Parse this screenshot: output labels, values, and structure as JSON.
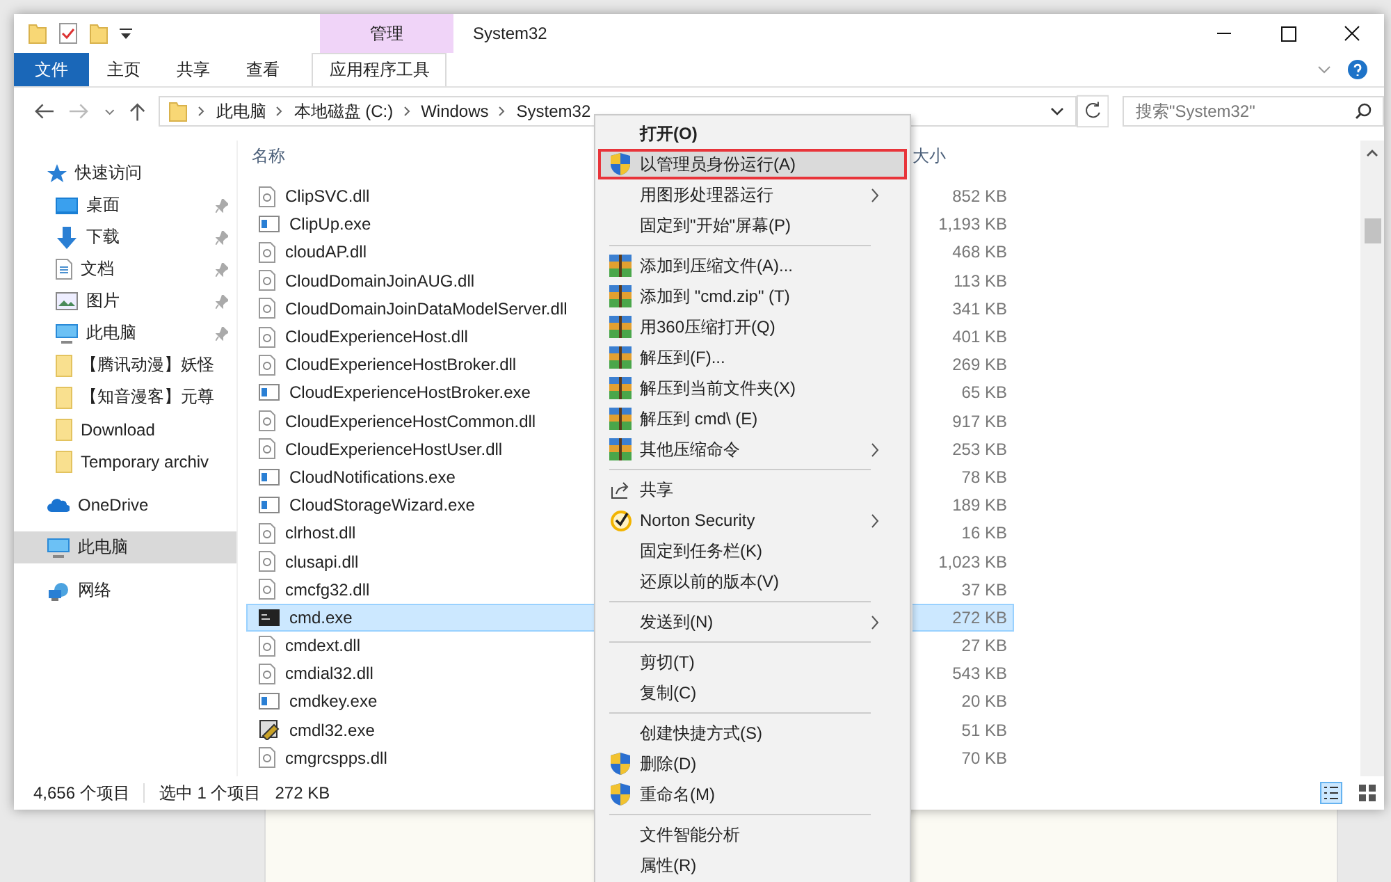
{
  "window": {
    "title": "System32",
    "context_group": "管理"
  },
  "ribbon_tabs": [
    {
      "label": "文件",
      "kind": "file",
      "selected": false
    },
    {
      "label": "主页",
      "kind": "tab",
      "selected": false
    },
    {
      "label": "共享",
      "kind": "tab",
      "selected": false
    },
    {
      "label": "查看",
      "kind": "tab",
      "selected": false
    },
    {
      "label": "应用程序工具",
      "kind": "context",
      "selected": true
    }
  ],
  "address": {
    "crumbs": [
      "此电脑",
      "本地磁盘 (C:)",
      "Windows",
      "System32"
    ]
  },
  "search": {
    "placeholder": "搜索\"System32\""
  },
  "sidebar": {
    "items": [
      {
        "label": "快速访问",
        "kind": "star",
        "selected": false,
        "children": [
          {
            "label": "桌面",
            "kind": "desktop",
            "pinned": true,
            "selected": false
          },
          {
            "label": "下载",
            "kind": "download",
            "pinned": true,
            "selected": false
          },
          {
            "label": "文档",
            "kind": "document",
            "pinned": true,
            "selected": false
          },
          {
            "label": "图片",
            "kind": "pictures",
            "pinned": true,
            "selected": false
          },
          {
            "label": "此电脑",
            "kind": "pc",
            "pinned": true,
            "selected": false
          },
          {
            "label": "【腾讯动漫】妖怪",
            "kind": "folder",
            "pinned": false,
            "selected": false
          },
          {
            "label": "【知音漫客】元尊",
            "kind": "folder",
            "pinned": false,
            "selected": false
          },
          {
            "label": "Download",
            "kind": "folder",
            "pinned": false,
            "selected": false
          },
          {
            "label": "Temporary archiv",
            "kind": "folder",
            "pinned": false,
            "selected": false
          }
        ]
      },
      {
        "label": "OneDrive",
        "kind": "cloud",
        "selected": false
      },
      {
        "label": "此电脑",
        "kind": "pc",
        "selected": true
      },
      {
        "label": "网络",
        "kind": "network",
        "selected": false
      }
    ]
  },
  "table": {
    "columns": [
      "名称",
      "大小"
    ],
    "rows": [
      {
        "name": "ClipSVC.dll",
        "size": "852 KB",
        "kind": "dll",
        "selected": false
      },
      {
        "name": "ClipUp.exe",
        "size": "1,193 KB",
        "kind": "exe",
        "selected": false
      },
      {
        "name": "cloudAP.dll",
        "size": "468 KB",
        "kind": "dll",
        "selected": false
      },
      {
        "name": "CloudDomainJoinAUG.dll",
        "size": "113 KB",
        "kind": "dll",
        "selected": false
      },
      {
        "name": "CloudDomainJoinDataModelServer.dll",
        "size": "341 KB",
        "kind": "dll",
        "selected": false
      },
      {
        "name": "CloudExperienceHost.dll",
        "size": "401 KB",
        "kind": "dll",
        "selected": false
      },
      {
        "name": "CloudExperienceHostBroker.dll",
        "size": "269 KB",
        "kind": "dll",
        "selected": false
      },
      {
        "name": "CloudExperienceHostBroker.exe",
        "size": "65 KB",
        "kind": "exe",
        "selected": false
      },
      {
        "name": "CloudExperienceHostCommon.dll",
        "size": "917 KB",
        "kind": "dll",
        "selected": false
      },
      {
        "name": "CloudExperienceHostUser.dll",
        "size": "253 KB",
        "kind": "dll",
        "selected": false
      },
      {
        "name": "CloudNotifications.exe",
        "size": "78 KB",
        "kind": "exe",
        "selected": false
      },
      {
        "name": "CloudStorageWizard.exe",
        "size": "189 KB",
        "kind": "exe",
        "selected": false
      },
      {
        "name": "clrhost.dll",
        "size": "16 KB",
        "kind": "dll",
        "selected": false
      },
      {
        "name": "clusapi.dll",
        "size": "1,023 KB",
        "kind": "dll",
        "selected": false
      },
      {
        "name": "cmcfg32.dll",
        "size": "37 KB",
        "kind": "dll",
        "selected": false
      },
      {
        "name": "cmd.exe",
        "size": "272 KB",
        "kind": "console",
        "selected": true
      },
      {
        "name": "cmdext.dll",
        "size": "27 KB",
        "kind": "dll",
        "selected": false
      },
      {
        "name": "cmdial32.dll",
        "size": "543 KB",
        "kind": "dll",
        "selected": false
      },
      {
        "name": "cmdkey.exe",
        "size": "20 KB",
        "kind": "exe",
        "selected": false
      },
      {
        "name": "cmdl32.exe",
        "size": "51 KB",
        "kind": "setup",
        "selected": false
      },
      {
        "name": "cmgrcspps.dll",
        "size": "70 KB",
        "kind": "dll",
        "selected": false
      }
    ]
  },
  "status_bar": {
    "count": "4,656 个项目",
    "selection": "选中 1 个项目",
    "size": "272 KB"
  },
  "context_menu": {
    "items": [
      {
        "kind": "plain",
        "label": "打开(O)",
        "bold": true,
        "submenu": false,
        "selected": false,
        "outlined": false
      },
      {
        "kind": "shield",
        "label": "以管理员身份运行(A)",
        "bold": false,
        "submenu": false,
        "selected": true,
        "outlined": true
      },
      {
        "kind": "plain",
        "label": "用图形处理器运行",
        "bold": false,
        "submenu": true,
        "selected": false,
        "outlined": false
      },
      {
        "kind": "plain",
        "label": "固定到\"开始\"屏幕(P)",
        "bold": false,
        "submenu": false,
        "selected": false,
        "outlined": false
      },
      {
        "kind": "separator"
      },
      {
        "kind": "archive",
        "label": "添加到压缩文件(A)...",
        "bold": false,
        "submenu": false,
        "selected": false,
        "outlined": false
      },
      {
        "kind": "archive",
        "label": "添加到 \"cmd.zip\" (T)",
        "bold": false,
        "submenu": false,
        "selected": false,
        "outlined": false
      },
      {
        "kind": "archive",
        "label": "用360压缩打开(Q)",
        "bold": false,
        "submenu": false,
        "selected": false,
        "outlined": false
      },
      {
        "kind": "archive",
        "label": "解压到(F)...",
        "bold": false,
        "submenu": false,
        "selected": false,
        "outlined": false
      },
      {
        "kind": "archive",
        "label": "解压到当前文件夹(X)",
        "bold": false,
        "submenu": false,
        "selected": false,
        "outlined": false
      },
      {
        "kind": "archive",
        "label": "解压到 cmd\\ (E)",
        "bold": false,
        "submenu": false,
        "selected": false,
        "outlined": false
      },
      {
        "kind": "archive",
        "label": "其他压缩命令",
        "bold": false,
        "submenu": true,
        "selected": false,
        "outlined": false
      },
      {
        "kind": "separator"
      },
      {
        "kind": "share",
        "label": "共享",
        "bold": false,
        "submenu": false,
        "selected": false,
        "outlined": false
      },
      {
        "kind": "norton",
        "label": "Norton Security",
        "bold": false,
        "submenu": true,
        "selected": false,
        "outlined": false
      },
      {
        "kind": "plain",
        "label": "固定到任务栏(K)",
        "bold": false,
        "submenu": false,
        "selected": false,
        "outlined": false
      },
      {
        "kind": "plain",
        "label": "还原以前的版本(V)",
        "bold": false,
        "submenu": false,
        "selected": false,
        "outlined": false
      },
      {
        "kind": "separator"
      },
      {
        "kind": "plain",
        "label": "发送到(N)",
        "bold": false,
        "submenu": true,
        "selected": false,
        "outlined": false
      },
      {
        "kind": "separator"
      },
      {
        "kind": "plain",
        "label": "剪切(T)",
        "bold": false,
        "submenu": false,
        "selected": false,
        "outlined": false
      },
      {
        "kind": "plain",
        "label": "复制(C)",
        "bold": false,
        "submenu": false,
        "selected": false,
        "outlined": false
      },
      {
        "kind": "separator"
      },
      {
        "kind": "plain",
        "label": "创建快捷方式(S)",
        "bold": false,
        "submenu": false,
        "selected": false,
        "outlined": false
      },
      {
        "kind": "shield",
        "label": "删除(D)",
        "bold": false,
        "submenu": false,
        "selected": false,
        "outlined": false
      },
      {
        "kind": "shield",
        "label": "重命名(M)",
        "bold": false,
        "submenu": false,
        "selected": false,
        "outlined": false
      },
      {
        "kind": "separator"
      },
      {
        "kind": "plain",
        "label": "文件智能分析",
        "bold": false,
        "submenu": false,
        "selected": false,
        "outlined": false
      },
      {
        "kind": "plain",
        "label": "属性(R)",
        "bold": false,
        "submenu": false,
        "selected": false,
        "outlined": false
      }
    ]
  }
}
